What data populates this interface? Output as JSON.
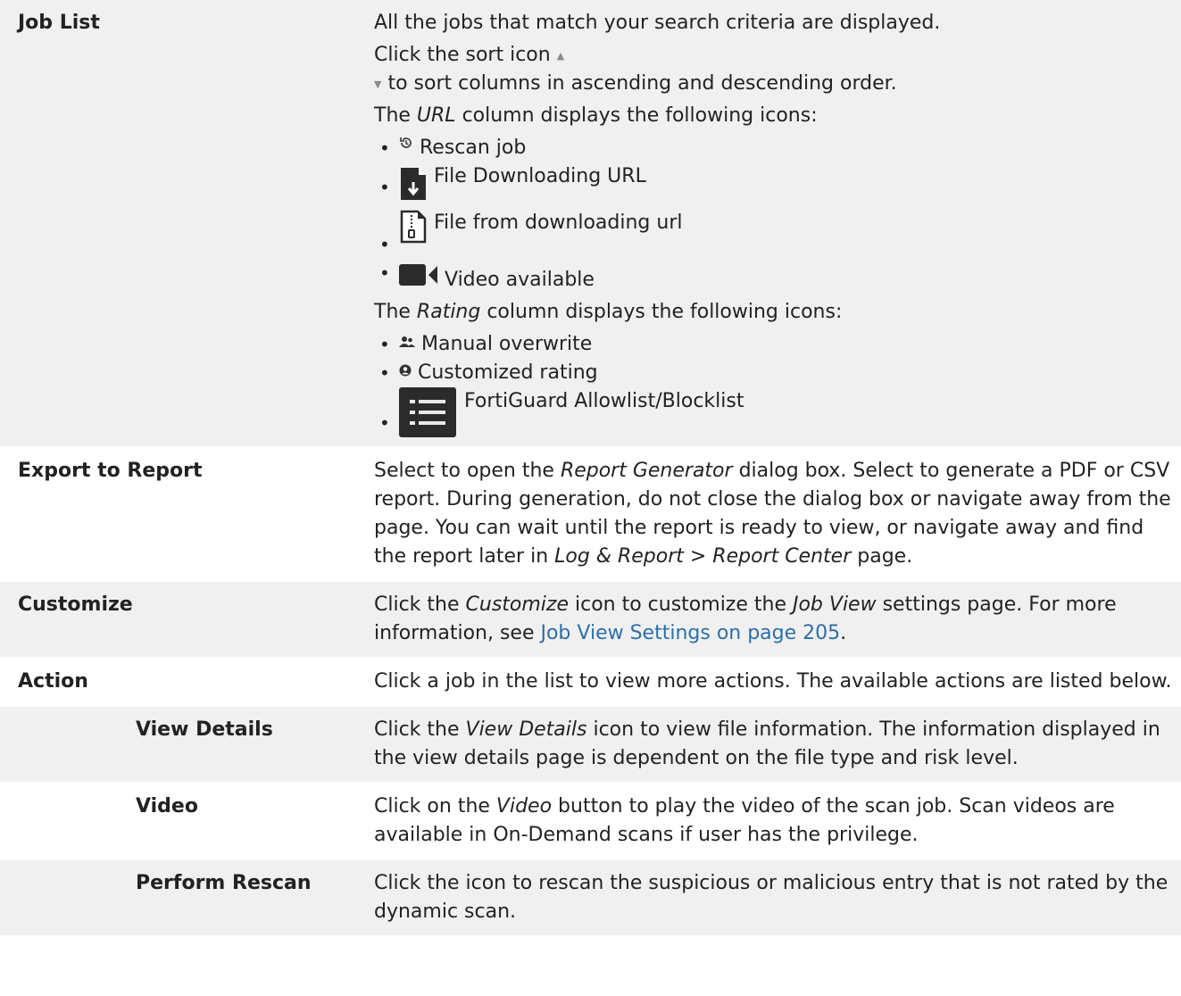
{
  "rows": {
    "job_list": {
      "label": "Job List",
      "line1": "All the jobs that match your search criteria are displayed.",
      "line2_pre": "Click the sort icon",
      "line2_post": "to sort columns in ascending and descending order.",
      "url_intro_pre": "The ",
      "url_intro_em": "URL",
      "url_intro_post": " column displays the following icons:",
      "url_icons": [
        {
          "icon": "rescan-icon",
          "label": "Rescan job"
        },
        {
          "icon": "file-download-icon",
          "label": "File Downloading URL"
        },
        {
          "icon": "zip-file-icon",
          "label": "File from downloading url"
        },
        {
          "icon": "video-camera-icon",
          "label": "Video available"
        }
      ],
      "rating_intro_pre": "The ",
      "rating_intro_em": "Rating",
      "rating_intro_post": " column displays the following icons:",
      "rating_icons": [
        {
          "icon": "users-icon",
          "label": "Manual overwrite"
        },
        {
          "icon": "user-circle-icon",
          "label": "Customized rating"
        },
        {
          "icon": "list-icon",
          "label": "FortiGuard Allowlist/Blocklist"
        }
      ]
    },
    "export": {
      "label": "Export to Report",
      "t1": "Select to open the ",
      "t1_em": "Report Generator",
      "t2": " dialog box. Select to generate a PDF or CSV report. During generation, do not close the dialog box or navigate away from the page. You can wait until the report is ready to view, or navigate away and find the report later in ",
      "t2_em": "Log & Report > Report Center",
      "t3": " page."
    },
    "customize": {
      "label": "Customize",
      "t1": "Click the ",
      "t1_em": "Customize",
      "t2": " icon to customize the ",
      "t2_em": "Job View",
      "t3": " settings page. For more information, see ",
      "link": "Job View Settings on page 205",
      "t4": "."
    },
    "action": {
      "label": "Action",
      "text": "Click a job in the list to view more actions. The available actions are listed below."
    },
    "view_details": {
      "label": "View Details",
      "t1": "Click the ",
      "t1_em": "View Details",
      "t2": " icon to view file information. The information displayed in the view details page is dependent on the file type and risk level."
    },
    "video": {
      "label": "Video",
      "t1": "Click on the ",
      "t1_em": "Video",
      "t2": " button to play the video of the scan job. Scan videos are available in On-Demand scans if user has the privilege."
    },
    "rescan": {
      "label": "Perform Rescan",
      "text": "Click the icon to rescan the suspicious or malicious entry that is not rated by the dynamic scan."
    }
  },
  "colors": {
    "row_alt_bg": "#f0f0f0",
    "link": "#2e6fa7",
    "text": "#222222"
  }
}
